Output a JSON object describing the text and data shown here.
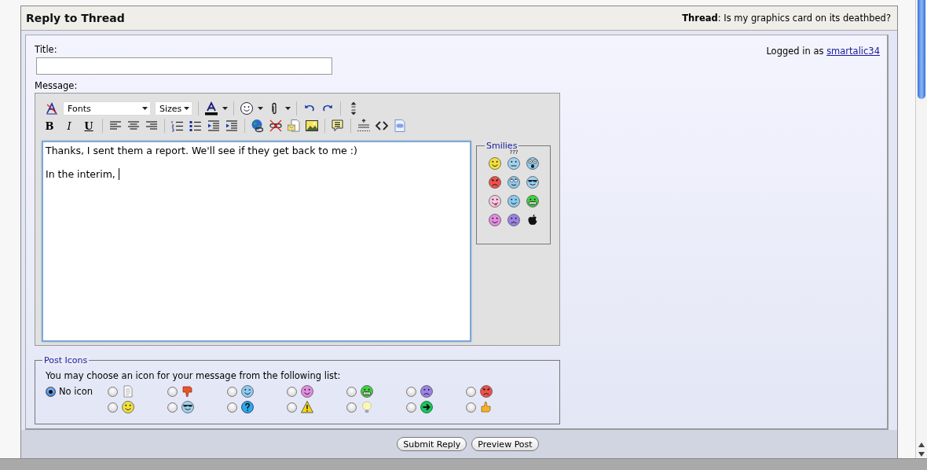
{
  "header": {
    "title": "Reply to Thread",
    "thread": "**Thread**: Is my graphics card on its deathbed?"
  },
  "login": {
    "text": "Logged in as",
    "user": "smartalic34"
  },
  "title_label": "Title:",
  "message_label": "Message:",
  "toolbar": {
    "fonts": "Fonts",
    "sizes": "Sizes",
    "row1": [
      {
        "kind": "removeformat"
      },
      {
        "kind": "fonts"
      },
      {
        "kind": "sizes"
      },
      {
        "kind": "sep"
      },
      {
        "kind": "fontcolor"
      },
      {
        "kind": "sep"
      },
      {
        "kind": "smiley"
      },
      {
        "kind": "clip"
      },
      {
        "kind": "sep"
      },
      {
        "kind": "undo"
      },
      {
        "kind": "redo"
      },
      {
        "kind": "sep"
      },
      {
        "kind": "resize"
      }
    ],
    "row2": [
      {
        "kind": "bold",
        "label": "B"
      },
      {
        "kind": "italic",
        "label": "I"
      },
      {
        "kind": "underline",
        "label": "U"
      },
      {
        "kind": "sep"
      },
      {
        "kind": "alignleft"
      },
      {
        "kind": "aligncenter"
      },
      {
        "kind": "alignright"
      },
      {
        "kind": "sep"
      },
      {
        "kind": "numlist"
      },
      {
        "kind": "bullist"
      },
      {
        "kind": "outdent"
      },
      {
        "kind": "indent"
      },
      {
        "kind": "sep"
      },
      {
        "kind": "link"
      },
      {
        "kind": "unlink"
      },
      {
        "kind": "email"
      },
      {
        "kind": "image"
      },
      {
        "kind": "sep"
      },
      {
        "kind": "quote"
      },
      {
        "kind": "sep"
      },
      {
        "kind": "wrap"
      },
      {
        "kind": "code"
      },
      {
        "kind": "php"
      }
    ]
  },
  "message": {
    "value": "Thanks, I sent them a report. We'll see if they get back to me :)\n\nIn the interim, "
  },
  "smilies": {
    "legend": "Smilies",
    "items": [
      {
        "kind": "smile",
        "color": "#f2e03c"
      },
      {
        "kind": "confused",
        "color": "#9fd3f2",
        "caption": "???"
      },
      {
        "kind": "shocked",
        "color": "#8ccaf0"
      },
      {
        "kind": "angry",
        "color": "#f0504a"
      },
      {
        "kind": "rolleyes",
        "color": "#8ccaf0"
      },
      {
        "kind": "cool",
        "color": "#9fd3f2"
      },
      {
        "kind": "tongue",
        "color": "#f7c6e6"
      },
      {
        "kind": "wink",
        "color": "#8ccaf0"
      },
      {
        "kind": "grin",
        "color": "#3fd23f"
      },
      {
        "kind": "smile",
        "color": "#e48be0"
      },
      {
        "kind": "frown",
        "color": "#9a82e6"
      },
      {
        "kind": "apple",
        "color": "#111111"
      }
    ]
  },
  "post_icons": {
    "legend": "Post Icons",
    "instruction": "You may choose an icon for your message from the following list:",
    "options": [
      {
        "label": "No icon",
        "selected": true
      },
      {
        "kind": "document",
        "color": "#ffffff",
        "selected": false
      },
      {
        "kind": "thumbsdown",
        "color": "#e8552a",
        "selected": false
      },
      {
        "kind": "wink",
        "color": "#8ccaf0",
        "selected": false
      },
      {
        "kind": "smile",
        "color": "#e48be0",
        "selected": false
      },
      {
        "kind": "grin",
        "color": "#3fd23f",
        "selected": false
      },
      {
        "kind": "frown",
        "color": "#9a82e6",
        "selected": false
      },
      {
        "kind": "angry",
        "color": "#f0504a",
        "selected": false
      },
      {
        "kind": "smile",
        "color": "#f2e03c",
        "selected": false
      },
      {
        "kind": "cool",
        "color": "#9fd3f2",
        "selected": false
      },
      {
        "kind": "question",
        "color": "#2aa9ee",
        "selected": false
      },
      {
        "kind": "warning",
        "color": "#f6d417",
        "selected": false
      },
      {
        "kind": "bulb",
        "color": "#fbf7b0",
        "selected": false
      },
      {
        "kind": "arrow",
        "color": "#1ec45a",
        "selected": false
      },
      {
        "kind": "thumbsup",
        "color": "#f3b22c",
        "selected": false
      }
    ]
  },
  "buttons": [
    "Submit Reply",
    "Preview Post"
  ]
}
